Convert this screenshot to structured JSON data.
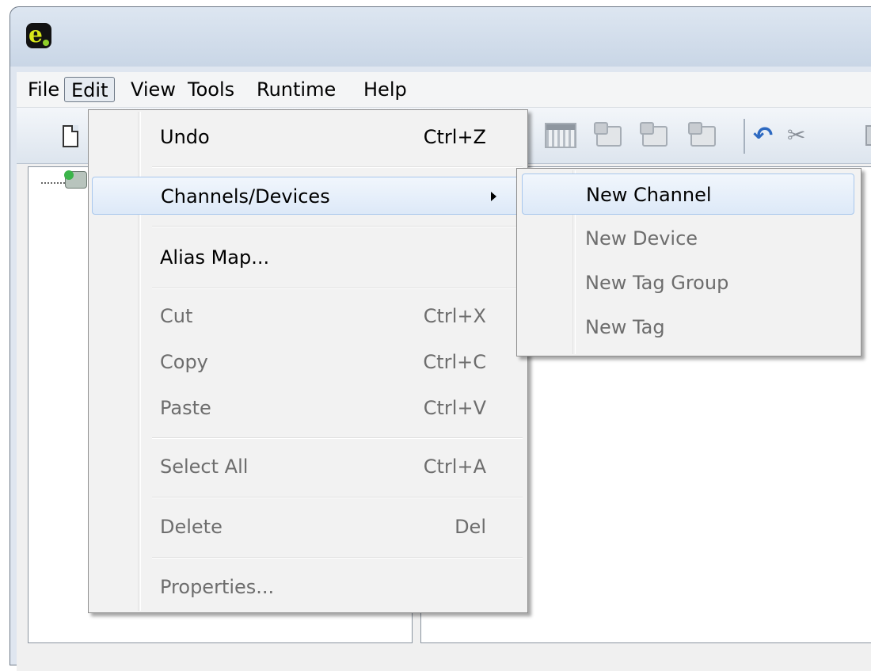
{
  "menubar": {
    "items": [
      {
        "label": "File"
      },
      {
        "label": "Edit"
      },
      {
        "label": "View"
      },
      {
        "label": "Tools"
      },
      {
        "label": "Runtime"
      },
      {
        "label": "Help"
      }
    ]
  },
  "edit_menu": {
    "items": [
      {
        "label": "Undo",
        "shortcut": "Ctrl+Z",
        "enabled": true
      },
      {
        "label": "Channels/Devices",
        "shortcut": "",
        "enabled": true,
        "has_submenu": true,
        "highlighted": true
      },
      {
        "label": "Alias Map...",
        "shortcut": "",
        "enabled": true
      },
      {
        "label": "Cut",
        "shortcut": "Ctrl+X",
        "enabled": false
      },
      {
        "label": "Copy",
        "shortcut": "Ctrl+C",
        "enabled": false
      },
      {
        "label": "Paste",
        "shortcut": "Ctrl+V",
        "enabled": false
      },
      {
        "label": "Select All",
        "shortcut": "Ctrl+A",
        "enabled": false
      },
      {
        "label": "Delete",
        "shortcut": "Del",
        "enabled": false
      },
      {
        "label": "Properties...",
        "shortcut": "",
        "enabled": false
      }
    ]
  },
  "channels_submenu": {
    "items": [
      {
        "label": "New Channel",
        "enabled": true,
        "highlighted": true
      },
      {
        "label": "New Device",
        "enabled": false
      },
      {
        "label": "New Tag Group",
        "enabled": false
      },
      {
        "label": "New Tag",
        "enabled": false
      }
    ]
  },
  "toolbar": {
    "icons": [
      "new-document-icon",
      "tag-grid-icon",
      "new-device-icon",
      "new-tag-group-icon",
      "properties-icon",
      "undo-icon",
      "cut-icon",
      "copy-icon"
    ]
  },
  "colors": {
    "highlight_border": "#a8c7ed",
    "menu_bg": "#f2f2f2",
    "disabled_text": "#6d6d6d",
    "undo_icon": "#2d69c1"
  }
}
